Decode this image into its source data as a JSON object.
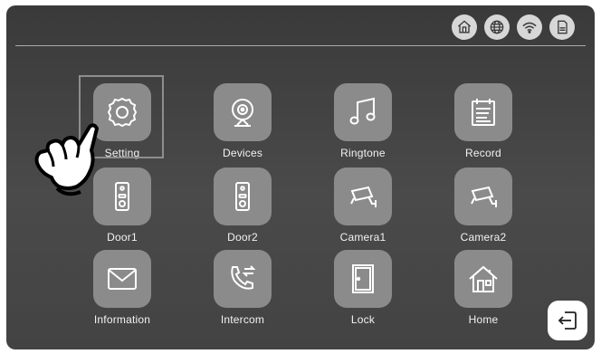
{
  "tiles": [
    {
      "label": "Setting",
      "icon": "gear-icon"
    },
    {
      "label": "Devices",
      "icon": "webcam-icon"
    },
    {
      "label": "Ringtone",
      "icon": "music-note-icon"
    },
    {
      "label": "Record",
      "icon": "calendar-icon"
    },
    {
      "label": "Door1",
      "icon": "doorbell-icon"
    },
    {
      "label": "Door2",
      "icon": "doorbell-icon"
    },
    {
      "label": "Camera1",
      "icon": "security-camera-icon"
    },
    {
      "label": "Camera2",
      "icon": "security-camera-icon"
    },
    {
      "label": "Information",
      "icon": "envelope-icon"
    },
    {
      "label": "Intercom",
      "icon": "phone-transfer-icon"
    },
    {
      "label": "Lock",
      "icon": "door-icon"
    },
    {
      "label": "Home",
      "icon": "house-icon"
    }
  ],
  "status_icons": [
    "home-status-icon",
    "globe-icon",
    "wifi-icon",
    "sd-card-icon"
  ],
  "colors": {
    "background": "#3f3f3f",
    "tile": "#8b8b8b",
    "label": "#f2f2f2",
    "selection": "#8e8e8e"
  }
}
